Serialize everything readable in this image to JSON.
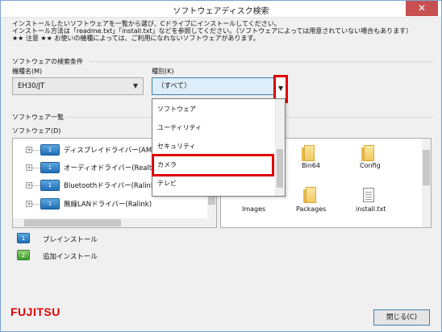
{
  "window": {
    "title": "ソフトウェアディスク検索",
    "close_glyph": "✕"
  },
  "info": {
    "line1": "インストールしたいソフトウェアを一覧から選び、Cドライブにインストールしてください。",
    "line2": "インストール方法は「readme.txt」「install.txt」などを参照してください。（ソフトウェアによっては用意されていない場合もあります）",
    "line3": "★★ 注意 ★★ お使いの機種によっては、ご利用になれないソフトウェアがあります。"
  },
  "search": {
    "group_label": "ソフトウェアの検索条件",
    "model_label": "機種名(M)",
    "model_value": "EH30/JT",
    "category_label": "種別(K)",
    "category_value": "（すべて）",
    "category_options": [
      "ソフトウェア",
      "ユーティリティ",
      "セキュリティ",
      "カメラ",
      "テレビ"
    ],
    "selected_option": "カメラ"
  },
  "list": {
    "group_label": "ソフトウェア一覧",
    "software_label": "ソフトウェア(D)",
    "items": [
      {
        "label": "ディスプレイドライバー(AMD)",
        "icon": "1"
      },
      {
        "label": "オーディオドライバー(Realtek)",
        "icon": "1"
      },
      {
        "label": "Bluetoothドライバー(Ralink)",
        "icon": "1"
      },
      {
        "label": "無線LANドライバー(Ralink)",
        "icon": "1"
      }
    ]
  },
  "files": [
    {
      "name": "Bin64",
      "type": "folder-icon"
    },
    {
      "name": "Config",
      "type": "folder-icon"
    },
    {
      "name": "Images",
      "type": "folder-icon"
    },
    {
      "name": "Packages",
      "type": "folder-icon"
    },
    {
      "name": "install.txt",
      "type": "text-file-icon"
    }
  ],
  "legend": [
    {
      "label": "プレインストール",
      "icon": "1",
      "color": "#1f6fb8"
    },
    {
      "label": "追加インストール",
      "icon": "2",
      "color": "#3f9e2f"
    }
  ],
  "footer": {
    "logo": "FUJITSU",
    "close_button": "閉じる(C)"
  },
  "colors": {
    "highlight": "#e00000",
    "title_close": "#c75050"
  }
}
